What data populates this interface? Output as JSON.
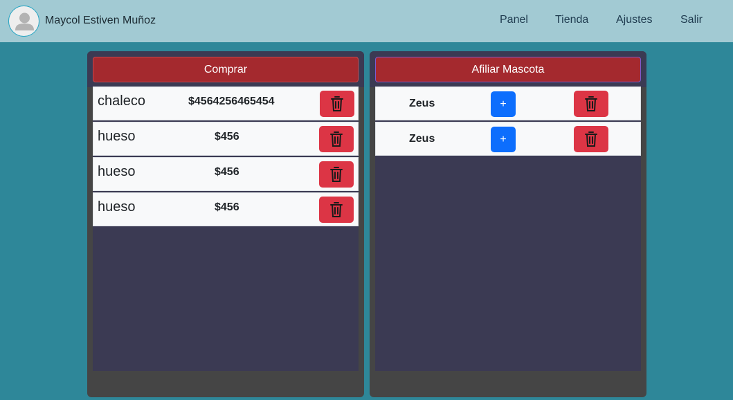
{
  "header": {
    "user_name": "Maycol Estiven Muñoz",
    "avatar_icon": "user-avatar-icon",
    "nav": [
      {
        "label": "Panel"
      },
      {
        "label": "Tienda"
      },
      {
        "label": "Ajustes"
      },
      {
        "label": "Salir"
      }
    ]
  },
  "cart": {
    "button_label": "Comprar",
    "items": [
      {
        "name": "chaleco",
        "price": "$4564256465454"
      },
      {
        "name": "hueso",
        "price": "$456"
      },
      {
        "name": "hueso",
        "price": "$456"
      },
      {
        "name": "hueso",
        "price": "$456"
      }
    ],
    "delete_icon": "trash-icon"
  },
  "pets": {
    "button_label": "Afiliar Mascota",
    "items": [
      {
        "name": "Zeus",
        "add_label": "+"
      },
      {
        "name": "Zeus",
        "add_label": "+"
      }
    ]
  },
  "colors": {
    "header_bg": "#a2cad3",
    "page_bg": "#2e8799",
    "panel_bg": "#3b3a53",
    "primary_action": "#a4292e",
    "danger": "#dc3545",
    "primary": "#0d6efd"
  }
}
